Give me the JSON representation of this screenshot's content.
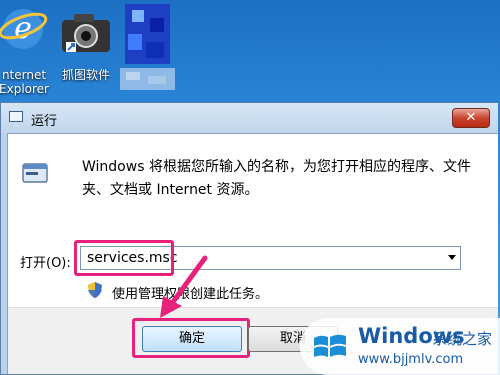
{
  "desktop": {
    "icons": [
      {
        "name": "internet-explorer",
        "label_line1": "nternet",
        "label_line2": "Explorer"
      },
      {
        "name": "screenshot-software",
        "label_line1": "抓图软件"
      }
    ]
  },
  "dialog": {
    "title": "运行",
    "close_symbol": "✕",
    "description": "Windows 将根据您所输入的名称，为您打开相应的程序、文件夹、文档或 Internet 资源。",
    "open_label": "打开(O):",
    "command_value": "services.msc",
    "admin_note": "使用管理权限创建此任务。",
    "ok_label": "确定",
    "cancel_label": "取消"
  },
  "watermark": {
    "title": "Windows",
    "subtitle": "系统之家",
    "url": "www.bjjmlv.com"
  },
  "colors": {
    "highlight": "#e8227a",
    "desktop_blue": "#2b86d8"
  }
}
